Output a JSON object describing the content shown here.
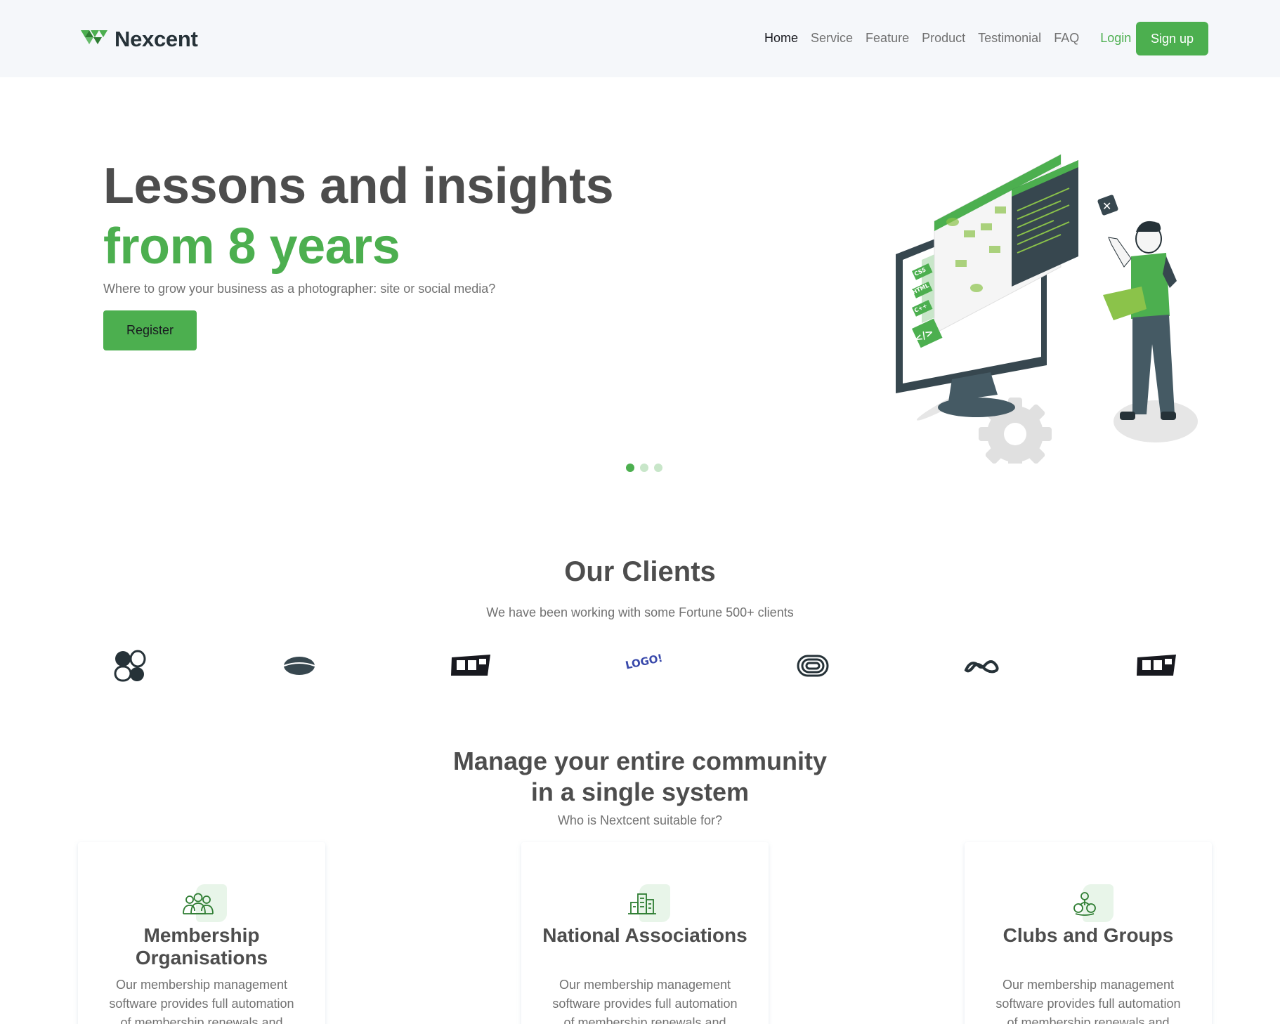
{
  "brand": {
    "name": "Nexcent"
  },
  "nav": {
    "items": [
      "Home",
      "Service",
      "Feature",
      "Product",
      "Testimonial",
      "FAQ"
    ],
    "login": "Login",
    "signup": "Sign up"
  },
  "hero": {
    "title_line1": "Lessons and insights",
    "title_line2": "from 8 years",
    "subtitle": "Where to grow your business as a photographer: site or social media?",
    "cta": "Register",
    "carousel": {
      "active_index": 0,
      "count": 3
    },
    "illustration_labels": [
      "CSS",
      "HTML",
      "C++"
    ]
  },
  "clients": {
    "title": "Our Clients",
    "subtitle": "We have been working with some Fortune 500+ clients",
    "logo_text": "LOGO! IPSUM",
    "logos": [
      "client-logo-1",
      "client-logo-2",
      "client-logo-3",
      "client-logo-4",
      "client-logo-5",
      "client-logo-6",
      "client-logo-7"
    ]
  },
  "community": {
    "title_line1": "Manage your entire community",
    "title_line2": "in a single system",
    "subtitle": "Who is Nextcent suitable for?",
    "cards": [
      {
        "title": "Membership Organisations",
        "icon": "people-group-icon",
        "desc": "Our membership management software provides full automation of membership renewals and payments"
      },
      {
        "title": "National Associations",
        "icon": "buildings-icon",
        "desc": "Our membership management software provides full automation of membership renewals and payments"
      },
      {
        "title": "Clubs and Groups",
        "icon": "hands-group-icon",
        "desc": "Our membership management software provides full automation of membership renewals and payments"
      }
    ]
  },
  "colors": {
    "primary": "#4caf4f",
    "text": "#4d4d4d",
    "muted": "#717171",
    "header_bg": "#f5f7fa"
  }
}
